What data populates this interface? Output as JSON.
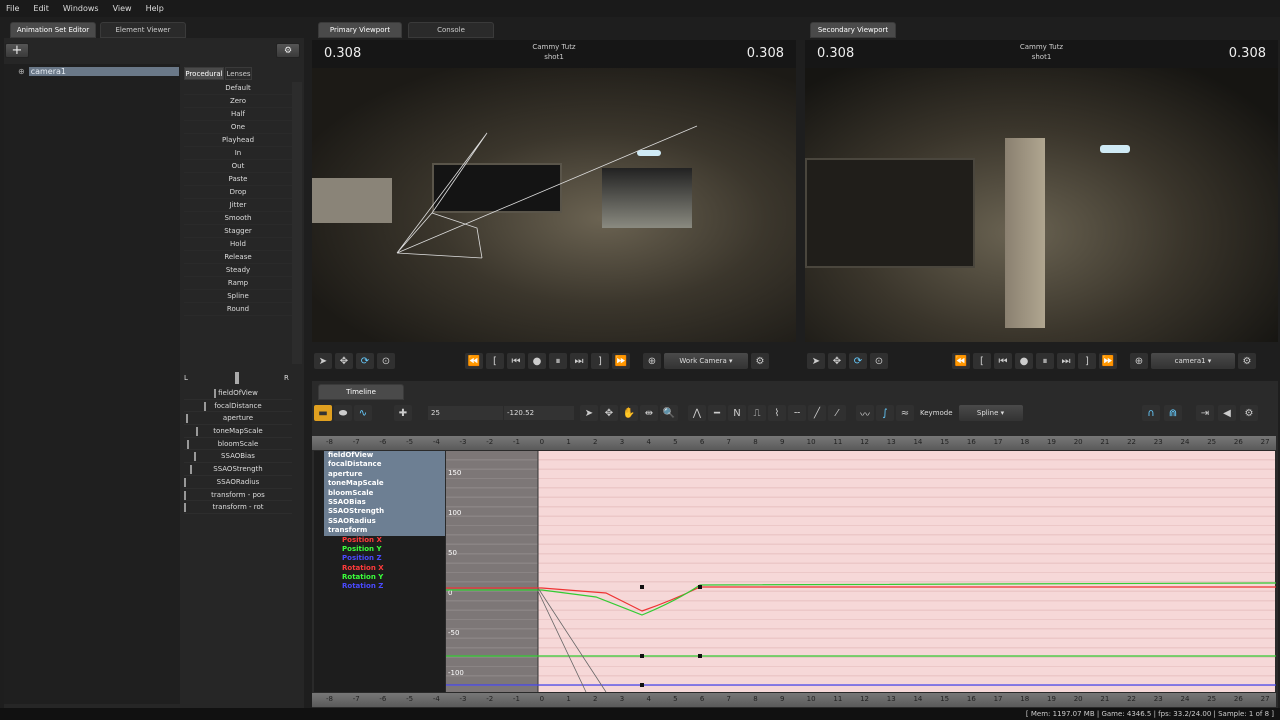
{
  "menu": [
    "File",
    "Edit",
    "Windows",
    "View",
    "Help"
  ],
  "left": {
    "tabs": [
      "Animation Set Editor",
      "Element Viewer"
    ],
    "tree_item": "camera1",
    "sub_tabs": [
      "Procedural",
      "Lenses"
    ],
    "procedural": [
      "Default",
      "Zero",
      "Half",
      "One",
      "Playhead",
      "In",
      "Out",
      "Paste",
      "Drop",
      "Jitter",
      "Smooth",
      "Stagger",
      "Hold",
      "Release",
      "Steady",
      "Ramp",
      "Spline",
      "Round"
    ],
    "balance_l": "L",
    "balance_r": "R",
    "controls": [
      "fieldOfView",
      "focalDistance",
      "aperture",
      "toneMapScale",
      "bloomScale",
      "SSAOBias",
      "SSAOStrength",
      "SSAORadius",
      "transform - pos",
      "transform - rot"
    ]
  },
  "primary": {
    "tabs": [
      "Primary Viewport",
      "Console"
    ],
    "left_val": "0.308",
    "right_val": "0.308",
    "title": "Cammy Tutz",
    "shot": "shot1",
    "camera": "Work Camera"
  },
  "secondary": {
    "tabs": [
      "Secondary Viewport"
    ],
    "left_val": "0.308",
    "right_val": "0.308",
    "title": "Cammy Tutz",
    "shot": "shot1",
    "camera": "camera1"
  },
  "timeline": {
    "tab": "Timeline",
    "field1": "25",
    "field2": "-120.52",
    "keymode_label": "Keymode",
    "keymode": "Spline",
    "ruler_start": -8,
    "ruler_end": 27,
    "tracks": [
      "fieldOfView",
      "focalDistance",
      "aperture",
      "toneMapScale",
      "bloomScale",
      "SSAOBias",
      "SSAOStrength",
      "SSAORadius",
      "transform"
    ],
    "subtracks": [
      {
        "name": "Position X",
        "color": "#ff3b3b"
      },
      {
        "name": "Position Y",
        "color": "#3bff3b"
      },
      {
        "name": "Position Z",
        "color": "#4a4aff"
      },
      {
        "name": "Rotation X",
        "color": "#ff3b3b"
      },
      {
        "name": "Rotation Y",
        "color": "#3bff3b"
      },
      {
        "name": "Rotation Z",
        "color": "#4a4aff"
      }
    ],
    "value_labels": [
      "150",
      "100",
      "50",
      "0",
      "-50",
      "-100"
    ]
  },
  "status": "[ Mem:  1197.07 MB | Game:   4346.5 | fps:   33.2/24.00 | Sample:        1 of 8 ]"
}
